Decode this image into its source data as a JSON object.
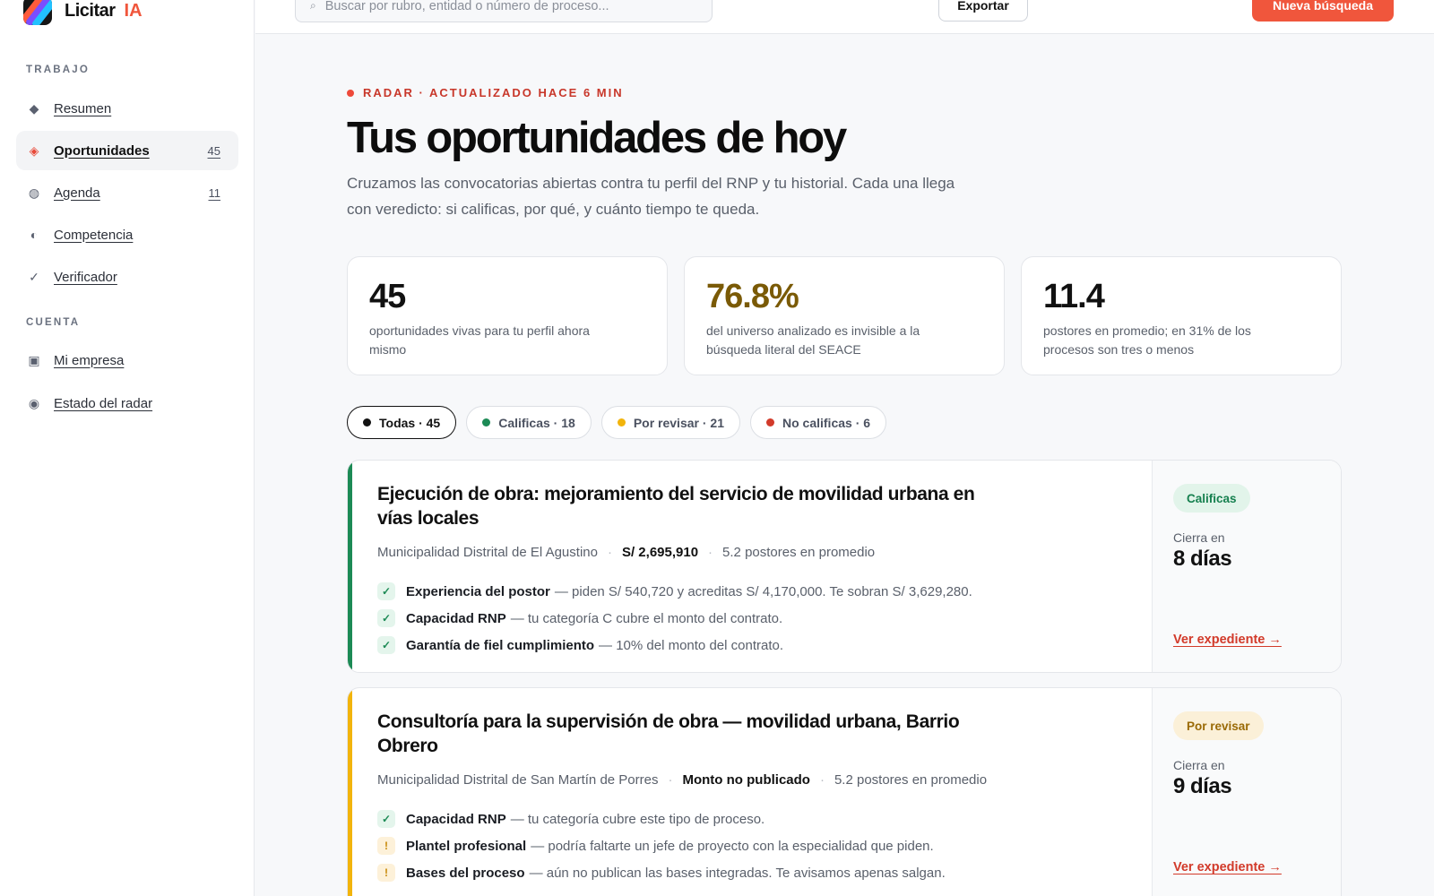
{
  "brand": {
    "name": "Licitar",
    "suffix": "IA"
  },
  "sidebar": {
    "work_label": "TRABAJO",
    "account_label": "CUENTA",
    "work_items": [
      {
        "label": "Resumen",
        "icon": "diamond-icon"
      },
      {
        "label": "Oportunidades",
        "icon": "radar-diamond-icon",
        "count": "45",
        "active": true
      },
      {
        "label": "Agenda",
        "icon": "calendar-icon",
        "count": "11"
      },
      {
        "label": "Competencia",
        "icon": "half-circle-icon"
      },
      {
        "label": "Verificador",
        "icon": "check-icon"
      }
    ],
    "account_items": [
      {
        "label": "Mi empresa",
        "icon": "building-icon"
      },
      {
        "label": "Estado del radar",
        "icon": "radar-status-icon"
      }
    ]
  },
  "topbar": {
    "search_placeholder": "Buscar por rubro, entidad o número de proceso...",
    "export_label": "Exportar",
    "new_search_label": "Nueva búsqueda"
  },
  "header": {
    "tag": "RADAR · ACTUALIZADO HACE 6 MIN",
    "title": "Tus oportunidades de hoy",
    "subtitle": "Cruzamos las convocatorias abiertas contra tu perfil del RNP y tu historial. Cada una llega con veredicto: si calificas, por qué, y cuánto tiempo te queda."
  },
  "stats": [
    {
      "value": "45",
      "desc": "oportunidades vivas para tu perfil ahora mismo"
    },
    {
      "value": "76.8%",
      "desc": "del universo analizado es invisible a la búsqueda literal del SEACE"
    },
    {
      "value": "11.4",
      "desc": "postores en promedio; en 31% de los procesos son tres o menos"
    }
  ],
  "filters": [
    {
      "label": "Todas · 45",
      "color": "#111111",
      "active": true
    },
    {
      "label": "Calificas · 18",
      "color": "#1c8a55"
    },
    {
      "label": "Por revisar · 21",
      "color": "#f2b40c"
    },
    {
      "label": "No calificas · 6",
      "color": "#d23a2a"
    }
  ],
  "opportunities": [
    {
      "title": "Ejecución de obra: mejoramiento del servicio de movilidad urbana en vías locales",
      "entity": "Municipalidad Distrital de El Agustino",
      "amount": "S/ 2,695,910",
      "bidders": "5.2 postores en promedio",
      "accent": "#1c8a55",
      "verdict": "Calificas",
      "closes_label": "Cierra en",
      "closes_value": "8 días",
      "link": "Ver expediente →",
      "requirements": [
        {
          "status": "ok",
          "mark": "✓",
          "name": "Experiencia del postor",
          "detail": "— piden S/ 540,720 y acreditas S/ 4,170,000. Te sobran S/ 3,629,280."
        },
        {
          "status": "ok",
          "mark": "✓",
          "name": "Capacidad RNP",
          "detail": "— tu categoría C cubre el monto del contrato."
        },
        {
          "status": "ok",
          "mark": "✓",
          "name": "Garantía de fiel cumplimiento",
          "detail": "— 10% del monto del contrato."
        }
      ]
    },
    {
      "title": "Consultoría para la supervisión de obra — movilidad urbana, Barrio Obrero",
      "entity": "Municipalidad Distrital de San Martín de Porres",
      "amount": "Monto no publicado",
      "bidders": "5.2 postores en promedio",
      "accent": "#f2b40c",
      "verdict": "Por revisar",
      "closes_label": "Cierra en",
      "closes_value": "9 días",
      "link": "Ver expediente →",
      "requirements": [
        {
          "status": "ok",
          "mark": "✓",
          "name": "Capacidad RNP",
          "detail": "— tu categoría cubre este tipo de proceso."
        },
        {
          "status": "warn",
          "mark": "!",
          "name": "Plantel profesional",
          "detail": "— podría faltarte un jefe de proyecto con la especialidad que piden."
        },
        {
          "status": "warn",
          "mark": "!",
          "name": "Bases del proceso",
          "detail": "— aún no publican las bases integradas. Te avisamos apenas salgan."
        }
      ]
    }
  ]
}
